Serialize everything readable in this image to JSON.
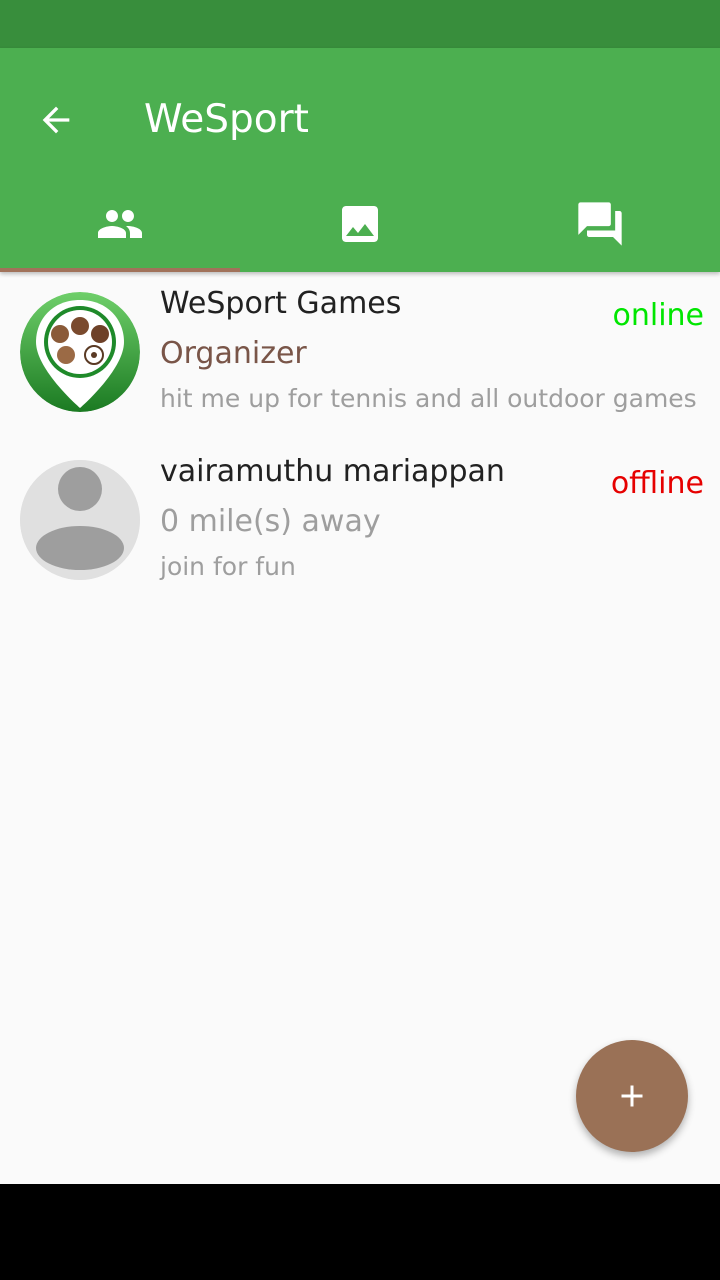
{
  "app": {
    "title": "WeSport"
  },
  "colors": {
    "status_bar": "#388e3c",
    "app_bar": "#4caf50",
    "tab_indicator": "#a1725a",
    "fab": "#9a7156",
    "online": "#00e600",
    "offline": "#e60000",
    "organizer": "#795548"
  },
  "tabs": [
    {
      "icon": "people-icon",
      "selected": true
    },
    {
      "icon": "image-icon",
      "selected": false
    },
    {
      "icon": "chat-icon",
      "selected": false
    }
  ],
  "members": [
    {
      "name": "WeSport Games",
      "subtitle": "Organizer",
      "description": "hit me up for tennis and all outdoor games",
      "status": "online",
      "avatar": "wesport-logo"
    },
    {
      "name": "vairamuthu mariappan",
      "subtitle": "0 mile(s) away",
      "description": "join for fun",
      "status": "offline",
      "avatar": "default-person"
    }
  ],
  "fab": {
    "icon": "plus-icon"
  }
}
